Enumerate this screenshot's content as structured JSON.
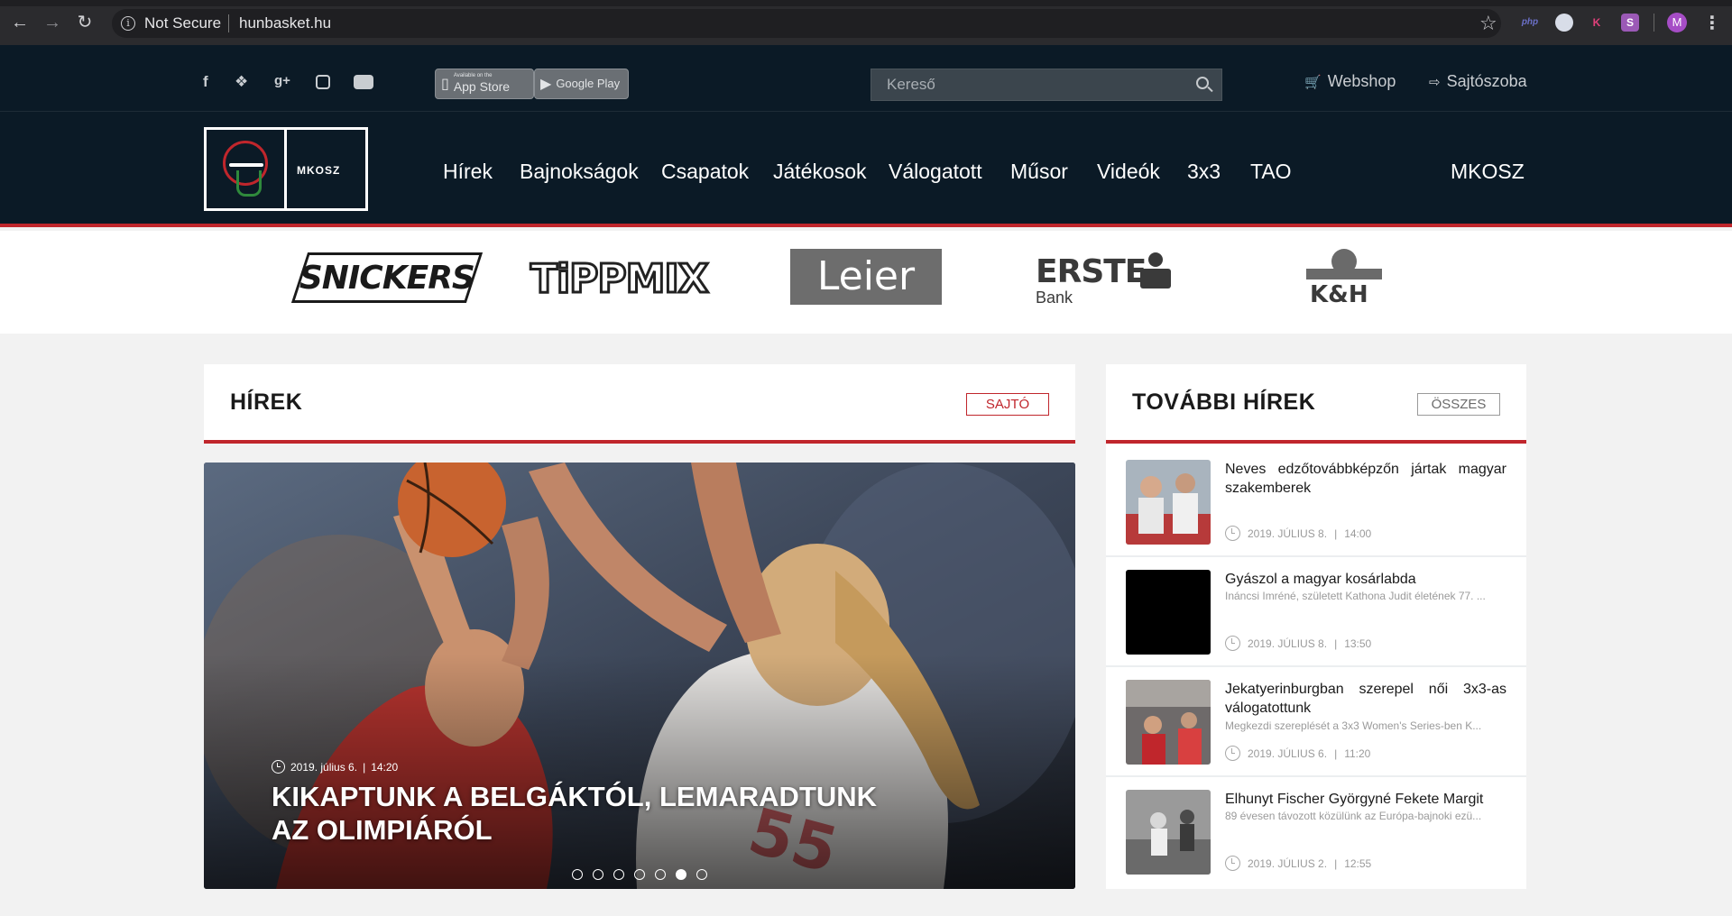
{
  "browser": {
    "security_label": "Not Secure",
    "url": "hunbasket.hu",
    "avatar_letter": "M",
    "extensions": [
      "php",
      "K",
      "S"
    ]
  },
  "topbar": {
    "social_icons": [
      "facebook-icon",
      "twitter-icon",
      "google-plus-icon",
      "instagram-icon",
      "youtube-icon"
    ],
    "app_store": {
      "small": "Available on the",
      "big": "App Store"
    },
    "google_play": {
      "big": "Google Play"
    },
    "search_placeholder": "Kereső",
    "webshop_label": "Webshop",
    "press_label": "Sajtószoba"
  },
  "nav": {
    "logo_text": "MKOSZ",
    "items": [
      "Hírek",
      "Bajnokságok",
      "Csapatok",
      "Játékosok",
      "Válogatott",
      "Műsor",
      "Videók",
      "3x3",
      "TAO"
    ],
    "right_item": "MKOSZ",
    "accent_color": "#c0262c",
    "bg_color": "#0b1a26"
  },
  "sponsors": {
    "snickers": "SNICKERS",
    "tippmix": "TiPPMIX",
    "leier": "Leier",
    "erste": {
      "name": "ERSTE",
      "sub": "Bank"
    },
    "kh": "K&H"
  },
  "news": {
    "title": "HÍREK",
    "tag_button": "SAJTÓ",
    "hero": {
      "date": "2019. július 6.",
      "time": "14:20",
      "headline": "KIKAPTUNK A BELGÁKTÓL, LEMARADTUNK AZ OLIMPIÁRÓL",
      "slide_count": 7,
      "active_slide": 6
    }
  },
  "more_news": {
    "title": "TOVÁBBI HÍREK",
    "all_button": "ÖSSZES",
    "items": [
      {
        "title": "Neves edzőtovábbképzőn jártak magyar szakemberek",
        "excerpt": "",
        "date": "2019. JÚLIUS 8.",
        "time": "14:00"
      },
      {
        "title": "Gyászol a magyar kosárlabda",
        "excerpt": "Ináncsi Imréné, született Kathona Judit életének 77. ...",
        "date": "2019. JÚLIUS 8.",
        "time": "13:50"
      },
      {
        "title": "Jekatyerinburgban szerepel női 3x3-as válogatottunk",
        "excerpt": "Megkezdi szereplését a 3x3 Women's Series-ben K...",
        "date": "2019. JÚLIUS 6.",
        "time": "11:20"
      },
      {
        "title": "Elhunyt Fischer Györgyné Fekete Margit",
        "excerpt": "89 évesen távozott közülünk az Európa-bajnoki ezü...",
        "date": "2019. JÚLIUS 2.",
        "time": "12:55"
      }
    ]
  }
}
